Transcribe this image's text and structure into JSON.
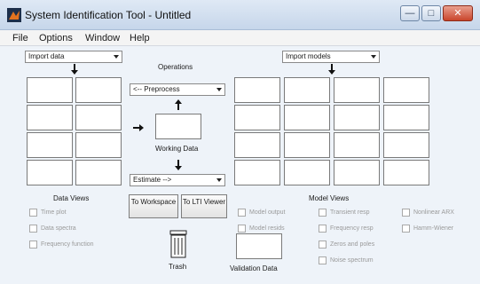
{
  "window": {
    "title": "System Identification Tool - Untitled",
    "minimize_label": "—",
    "maximize_label": "□",
    "close_label": "✕"
  },
  "menu": {
    "items": [
      "File",
      "Options",
      "Window",
      "Help"
    ]
  },
  "left_panel": {
    "import_data": "Import data",
    "data_views_title": "Data Views",
    "checkboxes": [
      "Time plot",
      "Data spectra",
      "Frequency function"
    ]
  },
  "center_panel": {
    "operations_label": "Operations",
    "preprocess": "<-- Preprocess",
    "working_data_label": "Working Data",
    "estimate": "Estimate -->",
    "to_workspace": "To Workspace",
    "to_lti_viewer": "To LTI Viewer",
    "trash_label": "Trash"
  },
  "right_panel": {
    "import_models": "Import models",
    "model_views_title": "Model Views",
    "validation_data_label": "Validation Data",
    "checkboxes_col1": [
      "Model output",
      "Model resids"
    ],
    "checkboxes_col2": [
      "Transient resp",
      "Frequency resp",
      "Zeros and poles",
      "Noise spectrum"
    ],
    "checkboxes_col3": [
      "Nonlinear ARX",
      "Hamm-Wiener"
    ]
  }
}
